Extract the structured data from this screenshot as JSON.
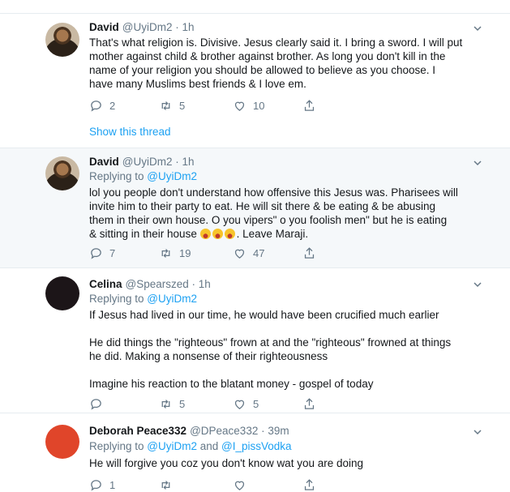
{
  "show_thread_label": "Show this thread",
  "tweets": [
    {
      "name": "David",
      "handle": "@UyiDm2 · 1h",
      "reply_prefix": "",
      "reply_to": "",
      "lines": [
        "That's what religion is. Divisive. Jesus clearly said it. I bring a sword. I will put",
        "mother against child & brother against brother. As long you don't kill in the",
        "name of your religion you should be allowed to believe as you choose. I",
        "have many Muslims best friends & I love em."
      ],
      "replies": "2",
      "retweets": "5",
      "likes": "10"
    },
    {
      "name": "David",
      "handle": "@UyiDm2 · 1h",
      "reply_prefix": "Replying to ",
      "reply_to": "@UyiDm2",
      "lines": [
        "lol you people don't understand how offensive this Jesus was. Pharisees will",
        "invite him to their party to eat. He will sit there & be eating & be abusing",
        "them in their own house. O you vipers\" o you foolish men\" but he is eating",
        "& sitting in their house"
      ],
      "last_line_tail": ". Leave Maraji.",
      "emoji_name": "face-with-tears-of-joy-icon",
      "replies": "7",
      "retweets": "19",
      "likes": "47"
    },
    {
      "name": "Celina",
      "handle": "@Spearszed · 1h",
      "reply_prefix": "Replying to ",
      "reply_to": "@UyiDm2",
      "lines": [
        "If Jesus had lived in our time, he would have been crucified much earlier",
        "",
        "He did things the \"righteous\" frown at and the \"righteous\" frowned at things",
        "he did. Making a nonsense of their righteousness",
        "",
        "Imagine his reaction to the blatant money - gospel of today"
      ],
      "replies": "",
      "retweets": "5",
      "likes": "5"
    },
    {
      "name": "Deborah Peace332",
      "handle": "@DPeace332 · 39m",
      "reply_prefix": "Replying to ",
      "reply_to": "@UyiDm2",
      "reply_and": " and ",
      "reply_to2": "@I_pissVodka",
      "lines": [
        "He will forgive you coz you don't know wat you are doing"
      ],
      "replies": "1",
      "retweets": "",
      "likes": ""
    }
  ],
  "colors": {
    "text": "#14171a",
    "secondary": "#657786",
    "link": "#1da1f2",
    "highlight_bg": "#f5f8fa",
    "divider": "#e6ecf0"
  }
}
